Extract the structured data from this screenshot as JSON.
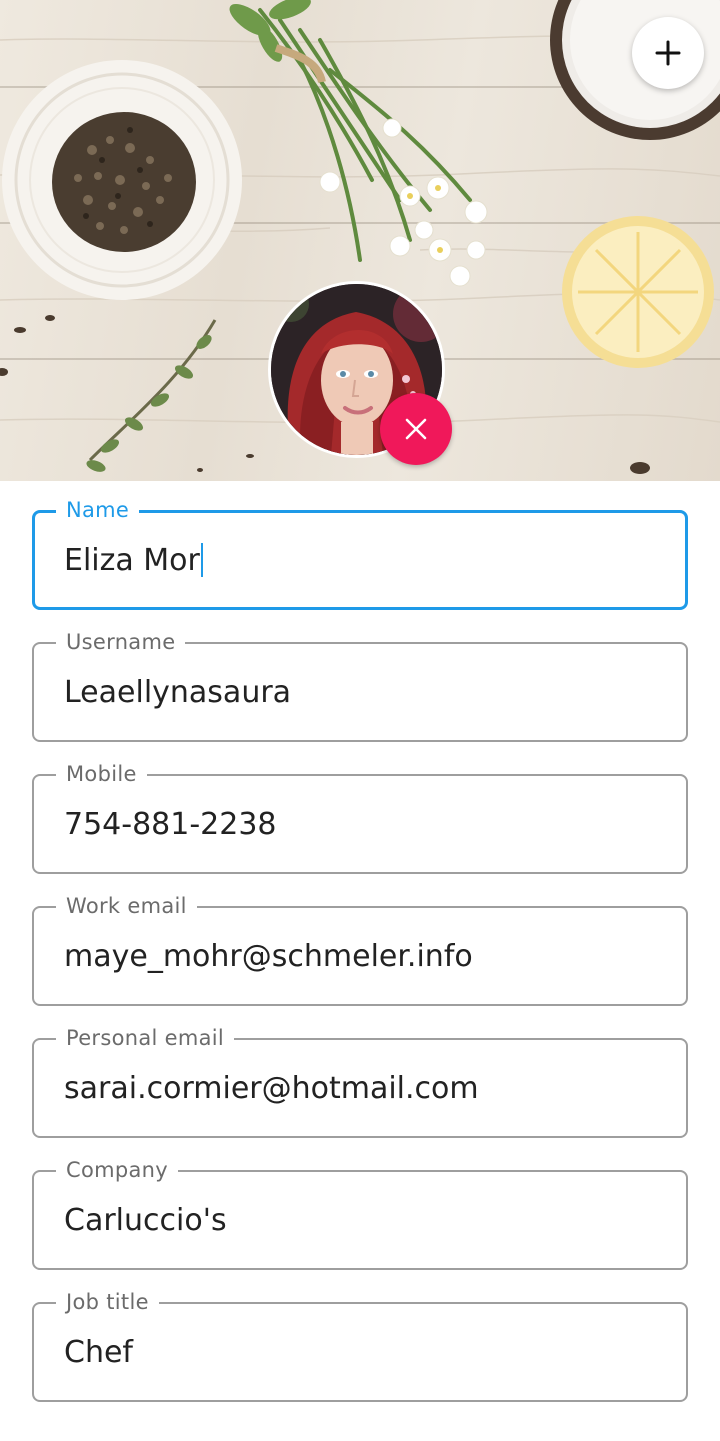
{
  "header": {
    "add_icon": "plus-icon",
    "remove_icon": "close-icon",
    "accent_color": "#f0185a"
  },
  "form": {
    "focus_color": "#1e9ae8",
    "fields": [
      {
        "label": "Name",
        "value": "Eliza Mor",
        "focused": true
      },
      {
        "label": "Username",
        "value": "Leaellynasaura"
      },
      {
        "label": "Mobile",
        "value": "754-881-2238"
      },
      {
        "label": "Work email",
        "value": "maye_mohr@schmeler.info"
      },
      {
        "label": "Personal email",
        "value": "sarai.cormier@hotmail.com"
      },
      {
        "label": "Company",
        "value": "Carluccio's"
      },
      {
        "label": "Job title",
        "value": "Chef"
      }
    ]
  }
}
